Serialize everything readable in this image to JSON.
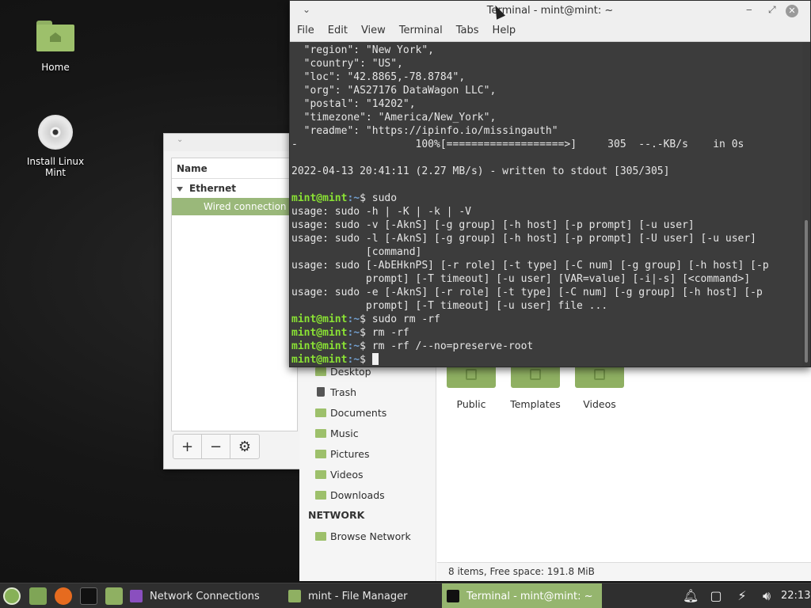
{
  "desktop": {
    "icons": [
      {
        "label": "Home"
      },
      {
        "label": "Install Linux\nMint"
      }
    ]
  },
  "network_window": {
    "column_header": "Name",
    "group": "Ethernet",
    "connection": "Wired connection",
    "buttons": {
      "add": "+",
      "remove": "−",
      "settings": "⚙"
    }
  },
  "file_manager": {
    "sidebar": {
      "items": [
        "Desktop",
        "Trash",
        "Documents",
        "Music",
        "Pictures",
        "Videos",
        "Downloads"
      ],
      "network_heading": "NETWORK",
      "network_items": [
        "Browse Network"
      ]
    },
    "folders": [
      "Public",
      "Templates",
      "Videos"
    ],
    "status": "8 items, Free space: 191.8 MiB"
  },
  "terminal": {
    "title": "Terminal - mint@mint: ~",
    "menu": [
      "File",
      "Edit",
      "View",
      "Terminal",
      "Tabs",
      "Help"
    ],
    "lines": [
      "  \"region\": \"New York\",",
      "  \"country\": \"US\",",
      "  \"loc\": \"42.8865,-78.8784\",",
      "  \"org\": \"AS27176 DataWagon LLC\",",
      "  \"postal\": \"14202\",",
      "  \"timezone\": \"America/New_York\",",
      "  \"readme\": \"https://ipinfo.io/missingauth\"",
      "-                   100%[===================>]     305  --.-KB/s    in 0s",
      "",
      "2022-04-13 20:41:11 (2.27 MB/s) - written to stdout [305/305]",
      ""
    ],
    "prompt_user": "mint@mint",
    "prompt_path": ":~",
    "prompt_symbol": "$",
    "session": [
      {
        "cmd": " sudo",
        "output": [
          "usage: sudo -h | -K | -k | -V",
          "usage: sudo -v [-AknS] [-g group] [-h host] [-p prompt] [-u user]",
          "usage: sudo -l [-AknS] [-g group] [-h host] [-p prompt] [-U user] [-u user]",
          "            [command]",
          "usage: sudo [-AbEHknPS] [-r role] [-t type] [-C num] [-g group] [-h host] [-p",
          "            prompt] [-T timeout] [-u user] [VAR=value] [-i|-s] [<command>]",
          "usage: sudo -e [-AknS] [-r role] [-t type] [-C num] [-g group] [-h host] [-p",
          "            prompt] [-T timeout] [-u user] file ..."
        ]
      },
      {
        "cmd": " sudo rm -rf",
        "output": []
      },
      {
        "cmd": " rm -rf",
        "output": []
      },
      {
        "cmd": " rm -rf /--no=preserve-root",
        "output": []
      },
      {
        "cmd": " ",
        "output": []
      }
    ]
  },
  "taskbar": {
    "tasks": [
      "Network Connections",
      "mint - File Manager",
      "Terminal - mint@mint: ~"
    ],
    "clock": "22:13"
  },
  "colors": {
    "accent": "#95b56e",
    "prompt_user": "#8ae234",
    "prompt_path": "#729fcf"
  }
}
